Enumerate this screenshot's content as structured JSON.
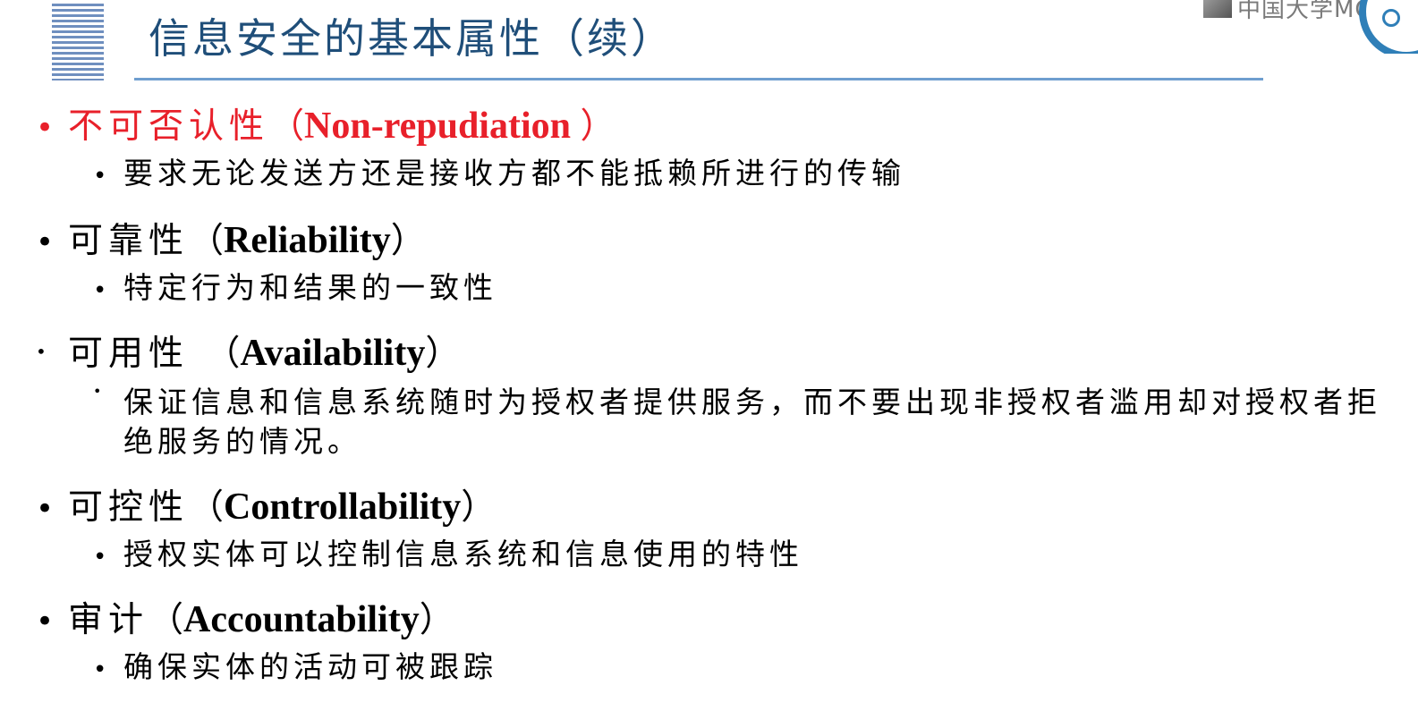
{
  "header": {
    "title": "信息安全的基本属性（续）",
    "watermark_text": "中国大学MOOC"
  },
  "items": [
    {
      "term": "不可否认性",
      "english": "Non-repudiation ",
      "open_paren": "（",
      "close_paren": "）",
      "description": "要求无论发送方还是接收方都不能抵赖所进行的传输"
    },
    {
      "term": "可靠性",
      "english": "Reliability",
      "open_paren": "（",
      "close_paren": "）",
      "description": "特定行为和结果的一致性"
    },
    {
      "term": "可用性 ",
      "english": "Availability",
      "open_paren": "（",
      "close_paren": "）",
      "description": "保证信息和信息系统随时为授权者提供服务，而不要出现非授权者滥用却对授权者拒绝服务的情况。"
    },
    {
      "term": "可控性",
      "english": "Controllability",
      "open_paren": "（",
      "close_paren": "）",
      "description": "授权实体可以控制信息系统和信息使用的特性"
    },
    {
      "term": "审计",
      "english": "Accountability",
      "open_paren": "（",
      "close_paren": "）",
      "description": "确保实体的活动可被跟踪"
    }
  ],
  "colors": {
    "title": "#1f4e79",
    "highlight": "#e8202a",
    "rule": "#6f9ecf"
  }
}
